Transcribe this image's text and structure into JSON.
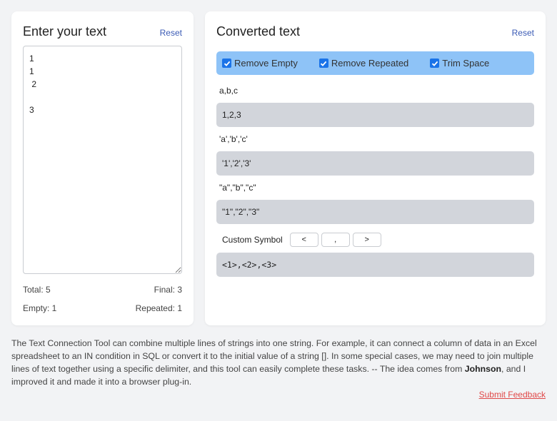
{
  "left": {
    "title": "Enter your text",
    "reset": "Reset",
    "input_value": "1\n1\n 2\n\n3",
    "total_label": "Total: 5",
    "final_label": "Final: 3",
    "empty_label": "Empty: 1",
    "repeated_label": "Repeated: 1"
  },
  "right": {
    "title": "Converted text",
    "reset": "Reset",
    "options": [
      {
        "label": "Remove Empty",
        "checked": true
      },
      {
        "label": "Remove Repeated",
        "checked": true
      },
      {
        "label": "Trim Space",
        "checked": true
      }
    ],
    "formats": [
      {
        "label": "a,b,c",
        "result": "1,2,3"
      },
      {
        "label": "'a','b','c'",
        "result": "'1','2','3'"
      },
      {
        "label": "\"a\",\"b\",\"c\"",
        "result": "\"1\",\"2\",\"3\""
      }
    ],
    "custom": {
      "label": "Custom Symbol",
      "prefix": "<",
      "separator": ",",
      "suffix": ">",
      "result": "<1>,<2>,<3>"
    }
  },
  "description": {
    "text_before": "The Text Connection Tool can combine multiple lines of strings into one string. For example, it can connect a column of data in an Excel spreadsheet to an IN condition in SQL or convert it to the initial value of a string []. In some special cases, we may need to join multiple lines of text together using a specific delimiter, and this tool can easily complete these tasks. -- The idea comes from ",
    "author": "Johnson",
    "text_after": ", and I improved it and made it into a browser plug-in."
  },
  "feedback": "Submit Feedback",
  "colors": {
    "options_bar": "#8ec3f7",
    "result_bg": "#d2d5db",
    "link": "#3b5bb5",
    "feedback": "#e04848",
    "checkbox": "#1a73e8"
  }
}
